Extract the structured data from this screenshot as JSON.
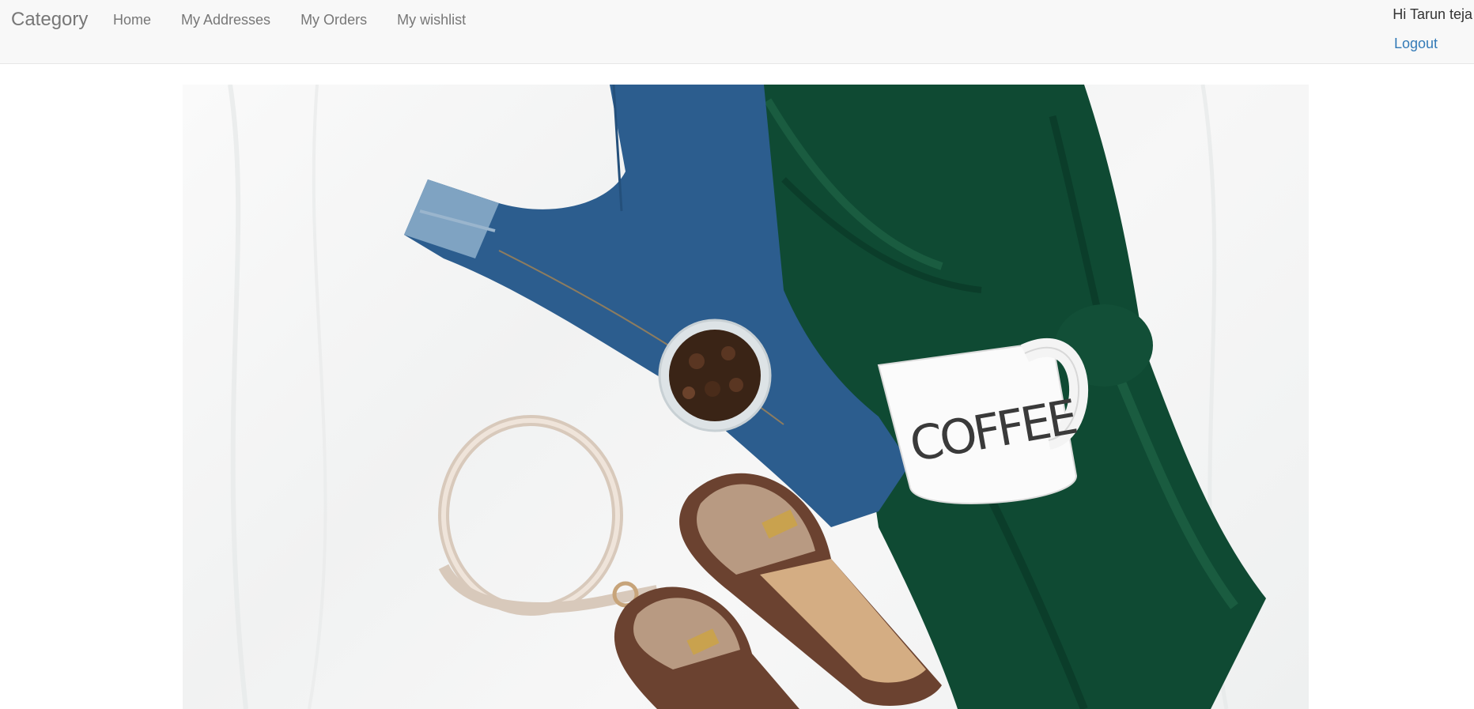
{
  "navbar": {
    "brand": "Category",
    "links": [
      {
        "label": "Home"
      },
      {
        "label": "My Addresses"
      },
      {
        "label": "My Orders"
      },
      {
        "label": "My wishlist"
      }
    ],
    "greeting": "Hi Tarun teja",
    "logout": "Logout"
  },
  "hero": {
    "mug_text": "COFFEE"
  }
}
